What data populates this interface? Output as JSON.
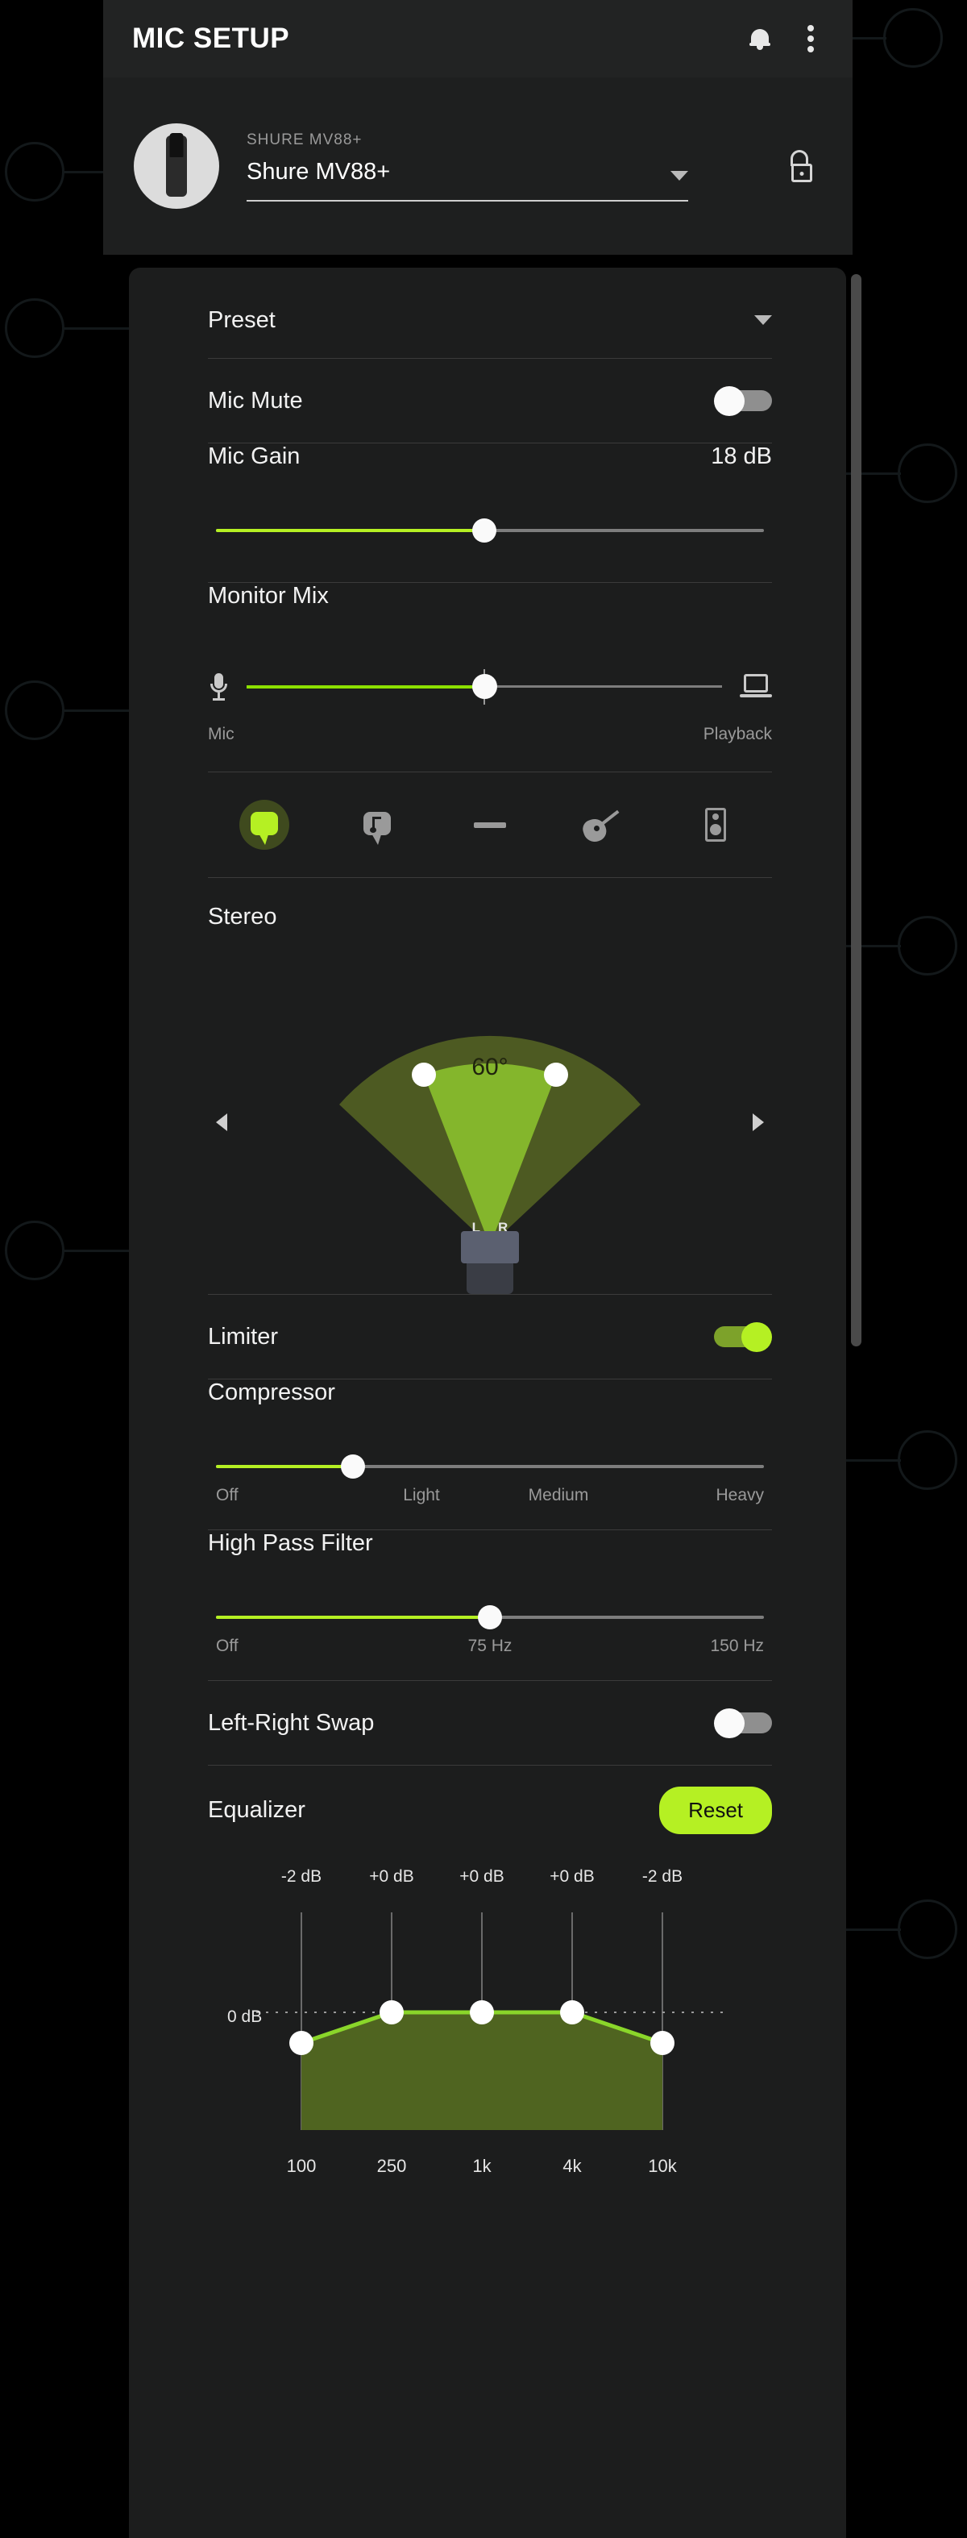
{
  "header": {
    "title": "MIC SETUP",
    "bell_icon": "bell-icon",
    "overflow_icon": "kebab-menu-icon"
  },
  "device": {
    "sub_label": "SHURE MV88+",
    "name": "Shure MV88+",
    "caret_icon": "chevron-down-icon",
    "lock_icon": "unlock-icon",
    "avatar_icon": "microphone-product-icon"
  },
  "preset": {
    "label": "Preset",
    "caret_icon": "chevron-down-icon"
  },
  "mic_mute": {
    "label": "Mic Mute",
    "state": "off"
  },
  "mic_gain": {
    "label": "Mic Gain",
    "value": "18 dB",
    "percent": 49
  },
  "monitor_mix": {
    "label": "Monitor Mix",
    "left_icon": "microphone-icon",
    "right_icon": "laptop-icon",
    "left_label": "Mic",
    "right_label": "Playback",
    "percent": 50
  },
  "preset_icons": [
    {
      "name": "speech-bubble-icon",
      "label": "Speech",
      "active": true
    },
    {
      "name": "music-bubble-icon",
      "label": "Singing",
      "active": false
    },
    {
      "name": "flat-icon",
      "label": "Flat",
      "active": false
    },
    {
      "name": "guitar-icon",
      "label": "Acoustic",
      "active": false
    },
    {
      "name": "speaker-icon",
      "label": "Loud",
      "active": false
    }
  ],
  "stereo": {
    "label": "Stereo",
    "angle": "60°",
    "left_channel": "L",
    "right_channel": "R",
    "prev_icon": "chevron-left-icon",
    "next_icon": "chevron-right-icon"
  },
  "limiter": {
    "label": "Limiter",
    "state": "on"
  },
  "compressor": {
    "label": "Compressor",
    "percent": 25,
    "scale": [
      "Off",
      "Light",
      "Medium",
      "Heavy"
    ]
  },
  "high_pass_filter": {
    "label": "High Pass Filter",
    "percent": 50,
    "scale": [
      "Off",
      "75 Hz",
      "150 Hz"
    ]
  },
  "left_right_swap": {
    "label": "Left-Right Swap",
    "state": "off"
  },
  "equalizer": {
    "label": "Equalizer",
    "reset_label": "Reset",
    "zero_label": "0 dB"
  },
  "colors": {
    "accent_green": "#b5f023",
    "muted_green": "#7da22a",
    "fill_green": "#4f6420",
    "panel": "#1c1d1d",
    "header": "#222323"
  },
  "chart_data": {
    "type": "line",
    "title": "Equalizer",
    "categories": [
      "100",
      "250",
      "1k",
      "4k",
      "10k"
    ],
    "values": [
      -2,
      0,
      0,
      0,
      -2
    ],
    "value_labels": [
      "-2 dB",
      "+0 dB",
      "+0 dB",
      "+0 dB",
      "-2 dB"
    ],
    "xlabel": "",
    "ylabel": "",
    "ylim": [
      -12,
      6
    ],
    "reference_line": "0 dB",
    "grid": true,
    "legend": "none"
  }
}
